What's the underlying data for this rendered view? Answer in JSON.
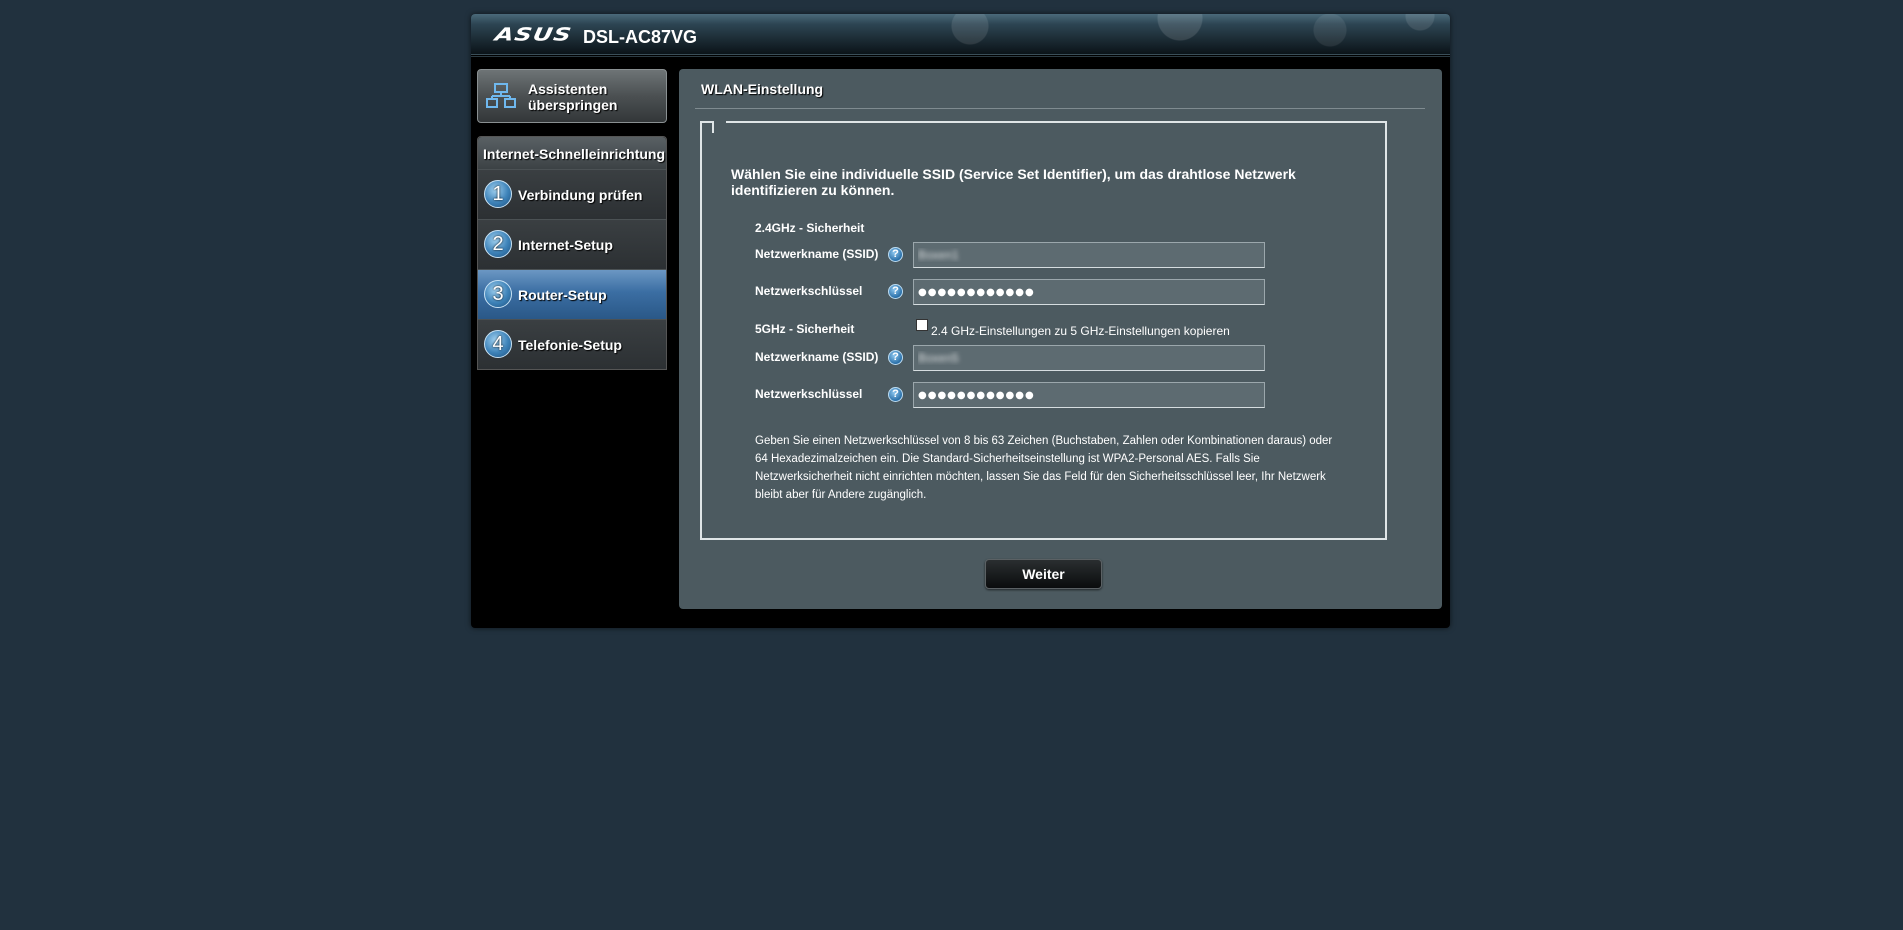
{
  "brand": {
    "logo": "ASUS",
    "model": "DSL-AC87VG"
  },
  "sidebar": {
    "skip_label": "Assistenten überspringen",
    "menu_title": "Internet-Schnelleinrichtung",
    "items": [
      {
        "num": "1",
        "label": "Verbindung prüfen",
        "active": false
      },
      {
        "num": "2",
        "label": "Internet-Setup",
        "active": false
      },
      {
        "num": "3",
        "label": "Router-Setup",
        "active": true
      },
      {
        "num": "4",
        "label": "Telefonie-Setup",
        "active": false
      }
    ]
  },
  "main": {
    "title": "WLAN-Einstellung",
    "intro": "Wählen Sie eine individuelle SSID (Service Set Identifier), um das drahtlose Netzwerk identifizieren zu können.",
    "band24": {
      "heading": "2.4GHz - Sicherheit",
      "ssid_label": "Netzwerkname (SSID)",
      "ssid_value": "Boxen1",
      "key_label": "Netzwerkschlüssel",
      "key_value": "●●●●●●●●●●●●"
    },
    "band5": {
      "heading": "5GHz - Sicherheit",
      "copy_label": "2.4 GHz-Einstellungen zu 5 GHz-Einstellungen kopieren",
      "copy_checked": false,
      "ssid_label": "Netzwerkname (SSID)",
      "ssid_value": "Boxen5",
      "key_label": "Netzwerkschlüssel",
      "key_value": "●●●●●●●●●●●●"
    },
    "help_glyph": "?",
    "note": "Geben Sie einen Netzwerkschlüssel von 8 bis 63 Zeichen (Buchstaben, Zahlen oder Kombinationen daraus) oder 64 Hexadezimalzeichen ein. Die Standard-Sicherheitseinstellung ist WPA2-Personal AES. Falls Sie Netzwerksicherheit nicht einrichten möchten, lassen Sie das Feld für den Sicherheitsschlüssel leer, Ihr Netzwerk bleibt aber für Andere zugänglich.",
    "next_label": "Weiter"
  },
  "colors": {
    "background": "#21313e",
    "panel": "#4c5a60",
    "active_menu": "#3b6ea3",
    "input_bg": "#5d6b71"
  },
  "icons": {
    "skip": "network-topology-icon",
    "help": "help-icon"
  }
}
